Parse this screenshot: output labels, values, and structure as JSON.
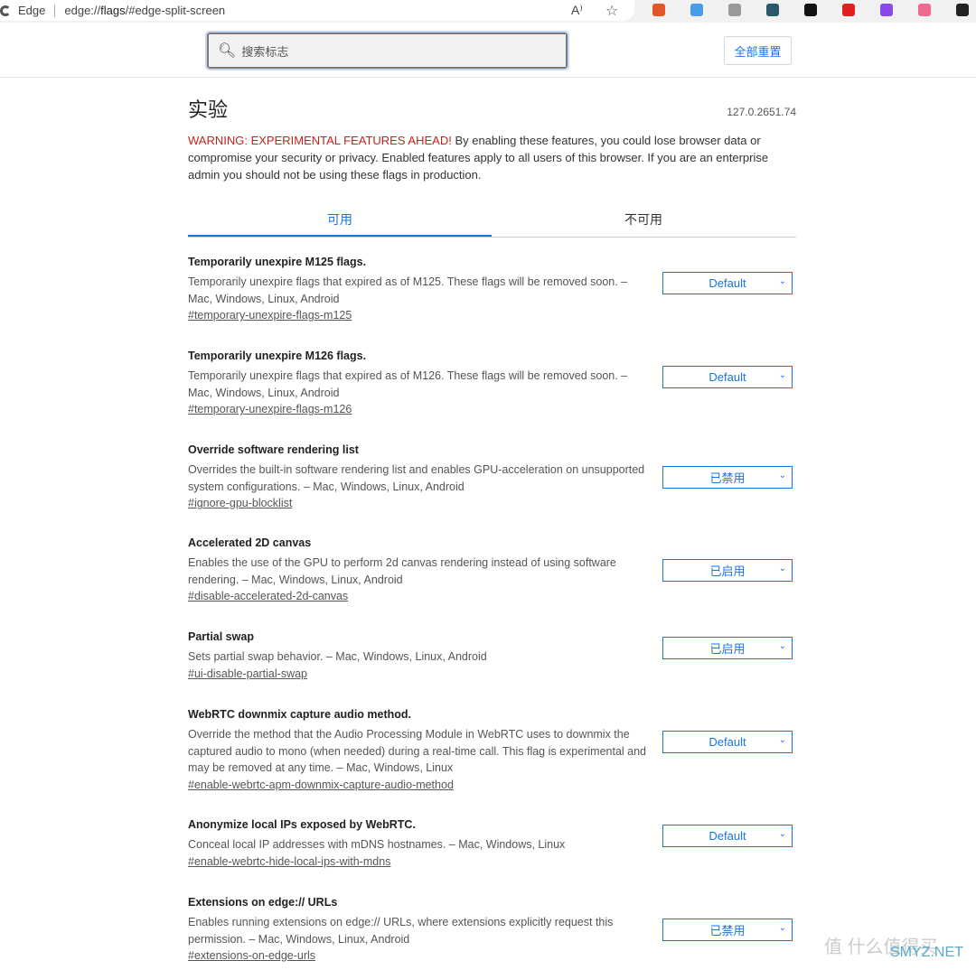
{
  "browser": {
    "app": "Edge",
    "url_prefix": "edge://",
    "url_bold": "flags",
    "url_suffix": "/#edge-split-screen",
    "read_aloud": "A⁾",
    "favorite": "☆"
  },
  "header": {
    "search_placeholder": "搜索标志",
    "reset_label": "全部重置"
  },
  "page": {
    "title": "实验",
    "version": "127.0.2651.74",
    "warning_red": "WARNING: EXPERIMENTAL FEATURES AHEAD!",
    "warning_text": " By enabling these features, you could lose browser data or compromise your security or privacy. Enabled features apply to all users of this browser. If you are an enterprise admin you should not be using these flags in production."
  },
  "tabs": [
    {
      "label": "可用",
      "active": true
    },
    {
      "label": "不可用",
      "active": false
    }
  ],
  "flags": [
    {
      "title": "Temporarily unexpire M125 flags.",
      "desc": "Temporarily unexpire flags that expired as of M125. These flags will be removed soon. – Mac, Windows, Linux, Android",
      "link": "#temporary-unexpire-flags-m125",
      "value": "Default"
    },
    {
      "title": "Temporarily unexpire M126 flags.",
      "desc": "Temporarily unexpire flags that expired as of M126. These flags will be removed soon. – Mac, Windows, Linux, Android",
      "link": "#temporary-unexpire-flags-m126",
      "value": "Default"
    },
    {
      "title": "Override software rendering list",
      "desc": "Overrides the built-in software rendering list and enables GPU-acceleration on unsupported system configurations. – Mac, Windows, Linux, Android",
      "link": "#ignore-gpu-blocklist",
      "value": "已禁用"
    },
    {
      "title": "Accelerated 2D canvas",
      "desc": "Enables the use of the GPU to perform 2d canvas rendering instead of using software rendering. – Mac, Windows, Linux, Android",
      "link": "#disable-accelerated-2d-canvas",
      "value": "已启用"
    },
    {
      "title": "Partial swap",
      "desc": "Sets partial swap behavior. – Mac, Windows, Linux, Android",
      "link": "#ui-disable-partial-swap",
      "value": "已启用"
    },
    {
      "title": "WebRTC downmix capture audio method.",
      "desc": "Override the method that the Audio Processing Module in WebRTC uses to downmix the captured audio to mono (when needed) during a real-time call. This flag is experimental and may be removed at any time. – Mac, Windows, Linux",
      "link": "#enable-webrtc-apm-downmix-capture-audio-method",
      "value": "Default"
    },
    {
      "title": "Anonymize local IPs exposed by WebRTC.",
      "desc": "Conceal local IP addresses with mDNS hostnames. – Mac, Windows, Linux",
      "link": "#enable-webrtc-hide-local-ips-with-mdns",
      "value": "Default"
    },
    {
      "title": "Extensions on edge:// URLs",
      "desc": "Enables running extensions on edge:// URLs, where extensions explicitly request this permission. – Mac, Windows, Linux, Android",
      "link": "#extensions-on-edge-urls",
      "value": "已禁用"
    }
  ],
  "watermark": {
    "text": "值 什么值得买",
    "site": "SMYZ.NET"
  },
  "extensions": [
    {
      "color": "#e0572b"
    },
    {
      "color": "#4a9be8"
    },
    {
      "color": "#999999"
    },
    {
      "color": "#2a5a6a"
    },
    {
      "color": "#111111"
    },
    {
      "color": "#e02020"
    },
    {
      "color": "#8a4ae8"
    },
    {
      "color": "#f06a90"
    },
    {
      "color": "#222222"
    }
  ]
}
